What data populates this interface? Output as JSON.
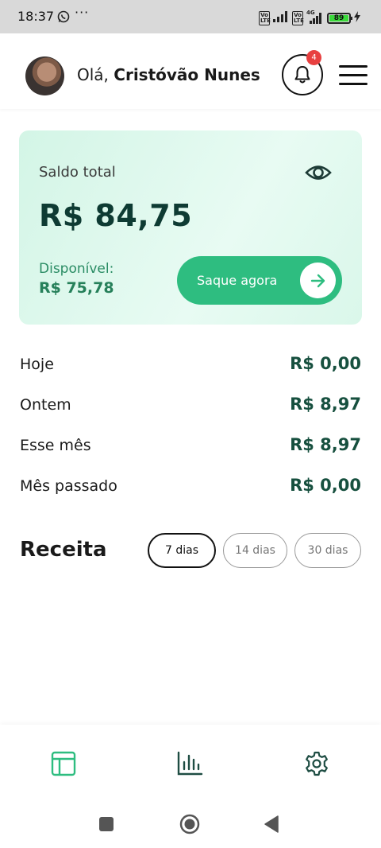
{
  "status_bar": {
    "time": "18:37",
    "more": "···",
    "volte_1": "Vo LTE",
    "volte_2": "Vo LTE",
    "network": "4G",
    "battery": "89"
  },
  "header": {
    "greeting_prefix": "Olá,",
    "user_name": "Cristóvão Nunes",
    "notification_count": "4"
  },
  "balance_card": {
    "label": "Saldo total",
    "total": "R$ 84,75",
    "available_label": "Disponível:",
    "available_value": "R$ 75,78",
    "withdraw_label": "Saque agora"
  },
  "stats": [
    {
      "label": "Hoje",
      "value": "R$ 0,00"
    },
    {
      "label": "Ontem",
      "value": "R$ 8,97"
    },
    {
      "label": "Esse mês",
      "value": "R$ 8,97"
    },
    {
      "label": "Mês passado",
      "value": "R$ 0,00"
    }
  ],
  "revenue": {
    "title": "Receita",
    "ranges": [
      {
        "label": "7 dias",
        "active": true
      },
      {
        "label": "14 dias",
        "active": false
      },
      {
        "label": "30 dias",
        "active": false
      }
    ]
  },
  "bottom_nav": [
    {
      "icon": "dashboard-icon"
    },
    {
      "icon": "bar-chart-icon"
    },
    {
      "icon": "gear-icon"
    }
  ],
  "colors": {
    "brand_green": "#2ebd80",
    "dark_green": "#17503f",
    "card_bg": "#e2f9ee",
    "badge_red": "#e84040"
  }
}
